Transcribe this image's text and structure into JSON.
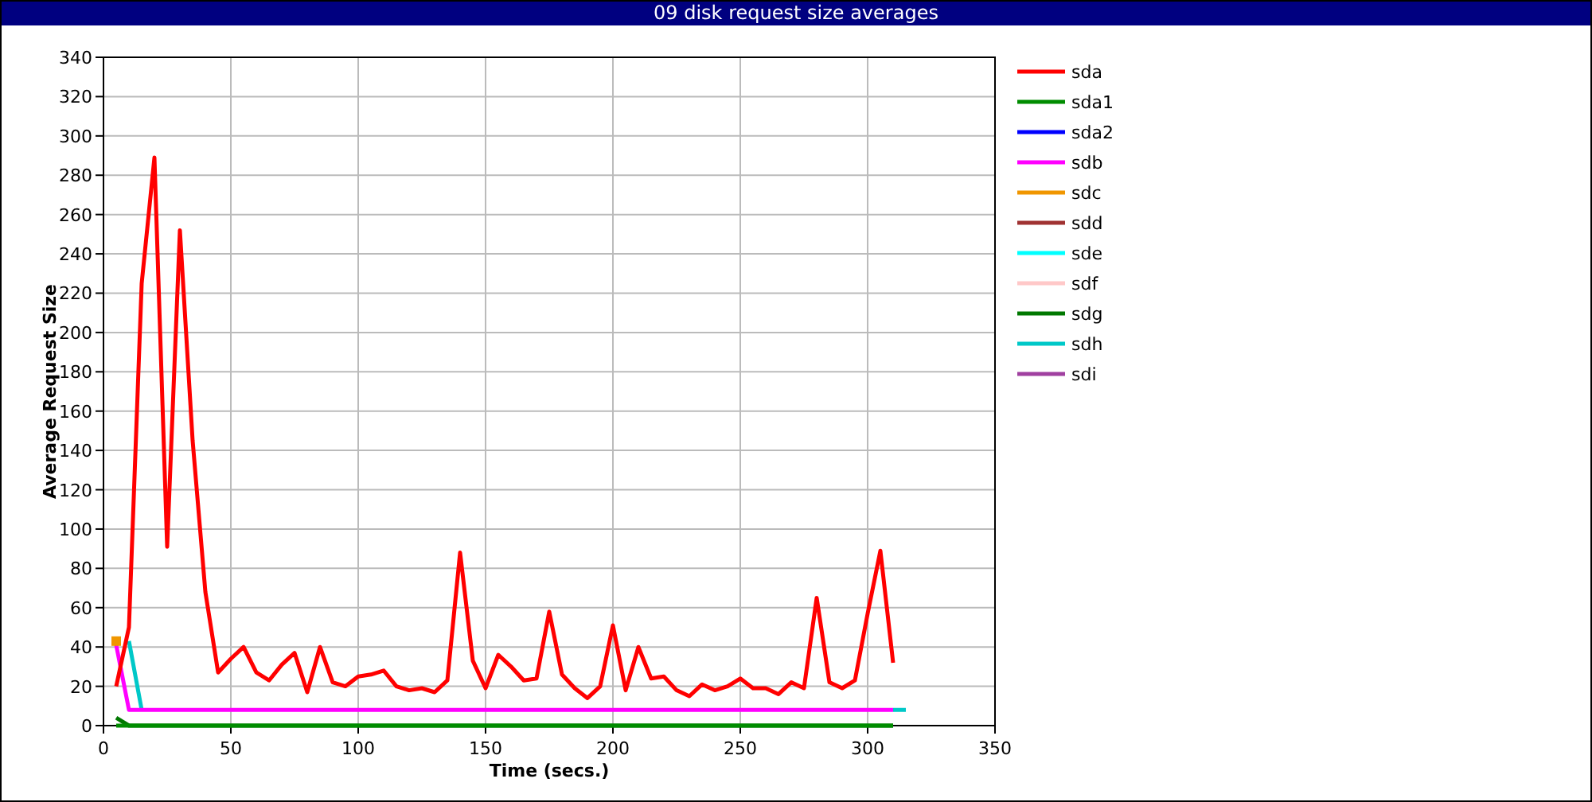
{
  "window": {
    "title": "09 disk request size averages"
  },
  "chart_data": {
    "type": "line",
    "xlabel": "Time (secs.)",
    "ylabel": "Average Request Size",
    "xlim": [
      0,
      350
    ],
    "ylim": [
      0,
      340
    ],
    "grid": true,
    "legend": true,
    "xticks": [
      0,
      50,
      100,
      150,
      200,
      250,
      300,
      350
    ],
    "yticks": [
      0,
      20,
      40,
      60,
      80,
      100,
      120,
      140,
      160,
      180,
      200,
      220,
      240,
      260,
      280,
      300,
      320,
      340
    ],
    "x": [
      5,
      10,
      15,
      20,
      25,
      30,
      35,
      40,
      45,
      50,
      55,
      60,
      65,
      70,
      75,
      80,
      85,
      90,
      95,
      100,
      105,
      110,
      115,
      120,
      125,
      130,
      135,
      140,
      145,
      150,
      155,
      160,
      165,
      170,
      175,
      180,
      185,
      190,
      195,
      200,
      205,
      210,
      215,
      220,
      225,
      230,
      235,
      240,
      245,
      250,
      255,
      260,
      265,
      270,
      275,
      280,
      285,
      290,
      295,
      300,
      305,
      310,
      315
    ],
    "series": [
      {
        "name": "sda",
        "color": "#ff0000",
        "values": [
          20,
          50,
          225,
          289,
          91,
          252,
          145,
          68,
          27,
          34,
          40,
          27,
          23,
          31,
          37,
          17,
          40,
          22,
          20,
          25,
          26,
          28,
          20,
          18,
          19,
          17,
          23,
          88,
          33,
          19,
          36,
          30,
          23,
          24,
          58,
          26,
          19,
          14,
          20,
          51,
          18,
          40,
          24,
          25,
          18,
          15,
          21,
          18,
          20,
          24,
          19,
          19,
          16,
          22,
          19,
          65,
          22,
          19,
          23,
          57,
          89,
          32,
          null
        ]
      },
      {
        "name": "sda1",
        "color": "#008c00",
        "values": [
          0,
          0,
          0,
          0,
          0,
          0,
          0,
          0,
          0,
          0,
          0,
          0,
          0,
          0,
          0,
          0,
          0,
          0,
          0,
          0,
          0,
          0,
          0,
          0,
          0,
          0,
          0,
          0,
          0,
          0,
          0,
          0,
          0,
          0,
          0,
          0,
          0,
          0,
          0,
          0,
          0,
          0,
          0,
          0,
          0,
          0,
          0,
          0,
          0,
          0,
          0,
          0,
          0,
          0,
          0,
          0,
          0,
          0,
          0,
          0,
          0,
          0,
          null
        ]
      },
      {
        "name": "sda2",
        "color": "#0000ff",
        "values": [
          null,
          null,
          null,
          null,
          null,
          null,
          null,
          null,
          null,
          null,
          null,
          null,
          null,
          null,
          null,
          null,
          null,
          null,
          null,
          null,
          null,
          null,
          null,
          null,
          null,
          null,
          null,
          null,
          null,
          null,
          null,
          null,
          null,
          null,
          null,
          null,
          null,
          null,
          null,
          null,
          null,
          null,
          null,
          null,
          null,
          null,
          null,
          null,
          null,
          null,
          null,
          null,
          null,
          null,
          null,
          null,
          null,
          null,
          null,
          null,
          null,
          null,
          null
        ]
      },
      {
        "name": "sdb",
        "color": "#ff00ff",
        "values": [
          41,
          8,
          8,
          8,
          8,
          8,
          8,
          8,
          8,
          8,
          8,
          8,
          8,
          8,
          8,
          8,
          8,
          8,
          8,
          8,
          8,
          8,
          8,
          8,
          8,
          8,
          8,
          8,
          8,
          8,
          8,
          8,
          8,
          8,
          8,
          8,
          8,
          8,
          8,
          8,
          8,
          8,
          8,
          8,
          8,
          8,
          8,
          8,
          8,
          8,
          8,
          8,
          8,
          8,
          8,
          8,
          8,
          8,
          8,
          8,
          8,
          8,
          null
        ]
      },
      {
        "name": "sdc",
        "color": "#f09600",
        "marker": "square",
        "values": [
          43,
          null,
          null,
          null,
          null,
          null,
          null,
          null,
          null,
          null,
          null,
          null,
          null,
          null,
          null,
          null,
          null,
          null,
          null,
          null,
          null,
          null,
          null,
          null,
          null,
          null,
          null,
          null,
          null,
          null,
          null,
          null,
          null,
          null,
          null,
          null,
          null,
          null,
          null,
          null,
          null,
          null,
          null,
          null,
          null,
          null,
          null,
          null,
          null,
          null,
          null,
          null,
          null,
          null,
          null,
          null,
          null,
          null,
          null,
          null,
          null,
          null,
          null
        ]
      },
      {
        "name": "sdd",
        "color": "#a03232",
        "values": [
          null,
          null,
          null,
          null,
          null,
          null,
          null,
          null,
          null,
          null,
          null,
          null,
          null,
          null,
          null,
          null,
          null,
          null,
          null,
          null,
          null,
          null,
          null,
          null,
          null,
          null,
          null,
          null,
          null,
          null,
          null,
          null,
          null,
          null,
          null,
          null,
          null,
          null,
          null,
          null,
          null,
          null,
          null,
          null,
          null,
          null,
          null,
          null,
          null,
          null,
          null,
          null,
          null,
          null,
          null,
          null,
          null,
          null,
          null,
          null,
          null,
          null,
          null
        ]
      },
      {
        "name": "sde",
        "color": "#00ffff",
        "values": [
          null,
          null,
          null,
          null,
          null,
          null,
          null,
          null,
          null,
          null,
          null,
          null,
          null,
          null,
          null,
          null,
          null,
          null,
          null,
          null,
          null,
          null,
          null,
          null,
          null,
          null,
          null,
          null,
          null,
          null,
          null,
          null,
          null,
          null,
          null,
          null,
          null,
          null,
          null,
          null,
          null,
          null,
          null,
          null,
          null,
          null,
          null,
          null,
          null,
          null,
          null,
          null,
          null,
          null,
          null,
          null,
          null,
          null,
          null,
          null,
          null,
          null,
          null
        ]
      },
      {
        "name": "sdf",
        "color": "#ffc8c8",
        "values": [
          null,
          null,
          null,
          null,
          null,
          null,
          null,
          null,
          null,
          null,
          null,
          null,
          null,
          null,
          null,
          null,
          null,
          null,
          null,
          null,
          null,
          null,
          null,
          null,
          null,
          null,
          null,
          null,
          null,
          null,
          null,
          null,
          null,
          null,
          null,
          null,
          null,
          null,
          null,
          null,
          null,
          null,
          null,
          null,
          null,
          null,
          null,
          null,
          null,
          null,
          null,
          null,
          null,
          null,
          null,
          null,
          null,
          null,
          null,
          null,
          null,
          null,
          null
        ]
      },
      {
        "name": "sdg",
        "color": "#007800",
        "values": [
          4,
          0,
          0,
          0,
          0,
          0,
          0,
          0,
          0,
          0,
          0,
          0,
          0,
          0,
          0,
          0,
          0,
          0,
          0,
          0,
          0,
          0,
          0,
          0,
          0,
          0,
          0,
          0,
          0,
          0,
          0,
          0,
          0,
          0,
          0,
          0,
          0,
          0,
          0,
          0,
          0,
          0,
          0,
          0,
          0,
          0,
          0,
          0,
          0,
          0,
          0,
          0,
          0,
          0,
          0,
          0,
          0,
          0,
          0,
          0,
          0,
          0,
          null
        ]
      },
      {
        "name": "sdh",
        "color": "#00c8c8",
        "values": [
          null,
          43,
          8,
          null,
          null,
          null,
          null,
          null,
          null,
          null,
          null,
          null,
          null,
          null,
          null,
          null,
          null,
          null,
          null,
          null,
          null,
          null,
          null,
          null,
          null,
          null,
          null,
          null,
          null,
          null,
          null,
          null,
          null,
          null,
          null,
          null,
          null,
          null,
          null,
          null,
          null,
          null,
          null,
          null,
          null,
          null,
          null,
          null,
          null,
          null,
          null,
          null,
          null,
          null,
          null,
          null,
          null,
          null,
          null,
          null,
          null,
          8,
          8
        ]
      },
      {
        "name": "sdi",
        "color": "#a040a0",
        "values": [
          null,
          null,
          null,
          null,
          null,
          null,
          null,
          null,
          null,
          null,
          null,
          null,
          null,
          null,
          null,
          null,
          null,
          null,
          null,
          null,
          null,
          null,
          null,
          null,
          null,
          null,
          null,
          null,
          null,
          null,
          null,
          null,
          null,
          null,
          null,
          null,
          null,
          null,
          null,
          null,
          null,
          null,
          null,
          null,
          null,
          null,
          null,
          null,
          null,
          null,
          null,
          null,
          null,
          null,
          null,
          null,
          null,
          null,
          null,
          null,
          null,
          null,
          null
        ]
      }
    ]
  }
}
